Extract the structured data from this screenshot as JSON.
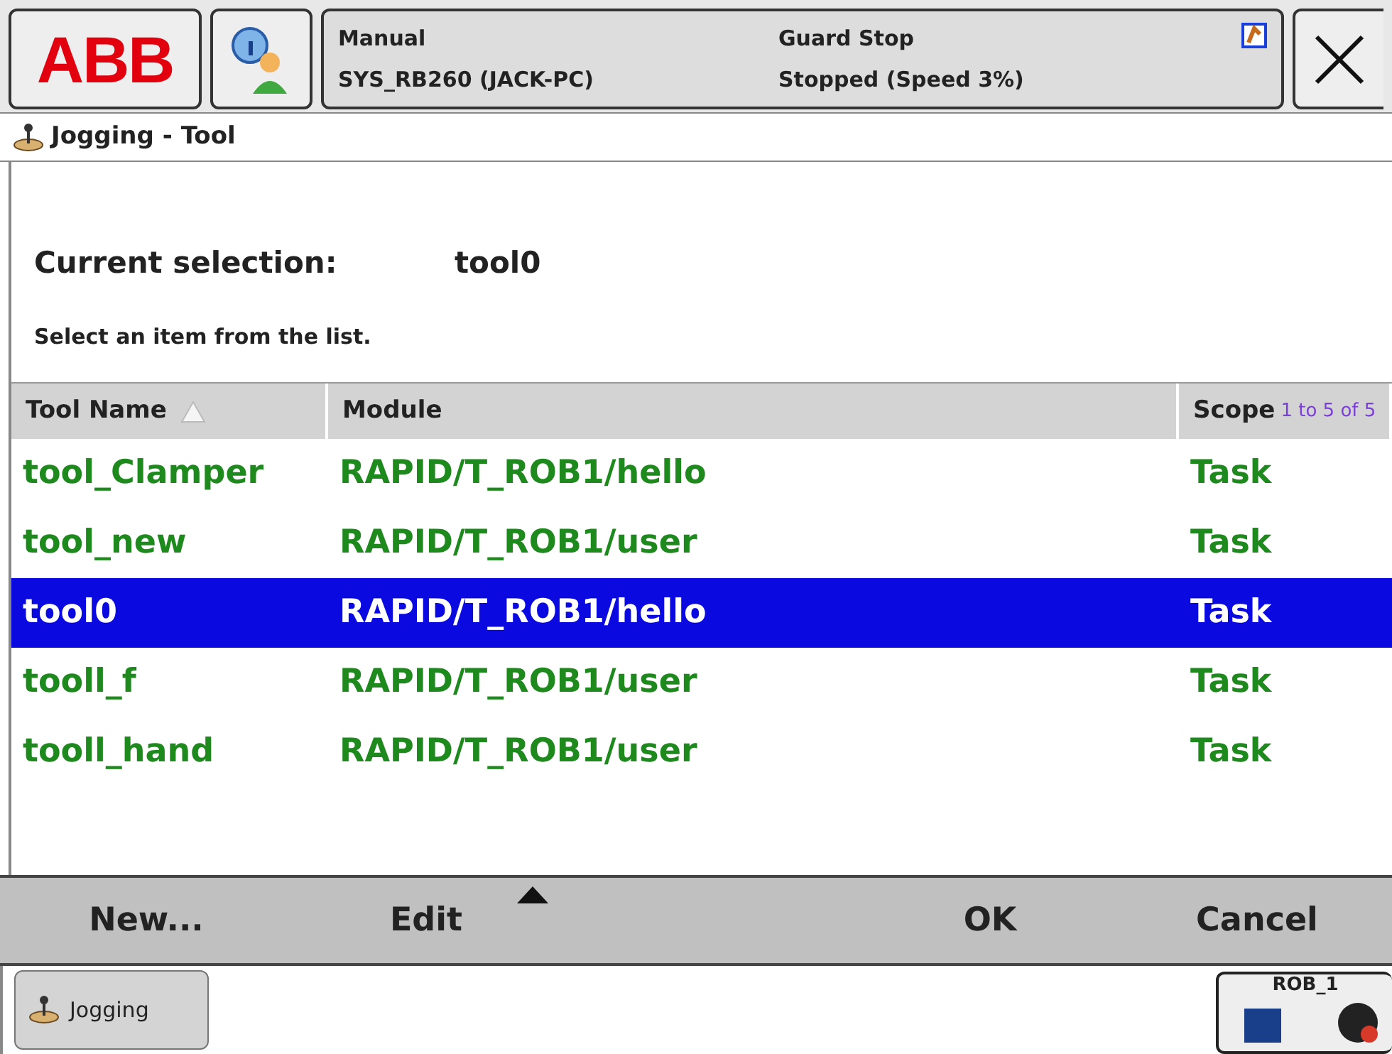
{
  "status": {
    "mode": "Manual",
    "system": "SYS_RB260 (JACK-PC)",
    "state": "Guard Stop",
    "run": "Stopped (Speed 3%)"
  },
  "logo": "ABB",
  "window": {
    "title": "Jogging - Tool"
  },
  "current_selection": {
    "label": "Current selection:",
    "value": "tool0"
  },
  "instruction": "Select an item from the list.",
  "table": {
    "columns": [
      "Tool Name",
      "Module",
      "Scope"
    ],
    "count": "1 to 5 of 5",
    "rows": [
      {
        "cells": [
          "tool_Clamper",
          "RAPID/T_ROB1/hello",
          "Task"
        ],
        "selected": false
      },
      {
        "cells": [
          "tool_new",
          "RAPID/T_ROB1/user",
          "Task"
        ],
        "selected": false
      },
      {
        "cells": [
          "tool0",
          "RAPID/T_ROB1/hello",
          "Task"
        ],
        "selected": true
      },
      {
        "cells": [
          "tooll_f",
          "RAPID/T_ROB1/user",
          "Task"
        ],
        "selected": false
      },
      {
        "cells": [
          "tooll_hand",
          "RAPID/T_ROB1/user",
          "Task"
        ],
        "selected": false
      }
    ]
  },
  "commands": [
    "New...",
    "Edit",
    "OK",
    "Cancel"
  ],
  "taskbar": {
    "app": "Jogging",
    "quickset": "ROB_1"
  }
}
